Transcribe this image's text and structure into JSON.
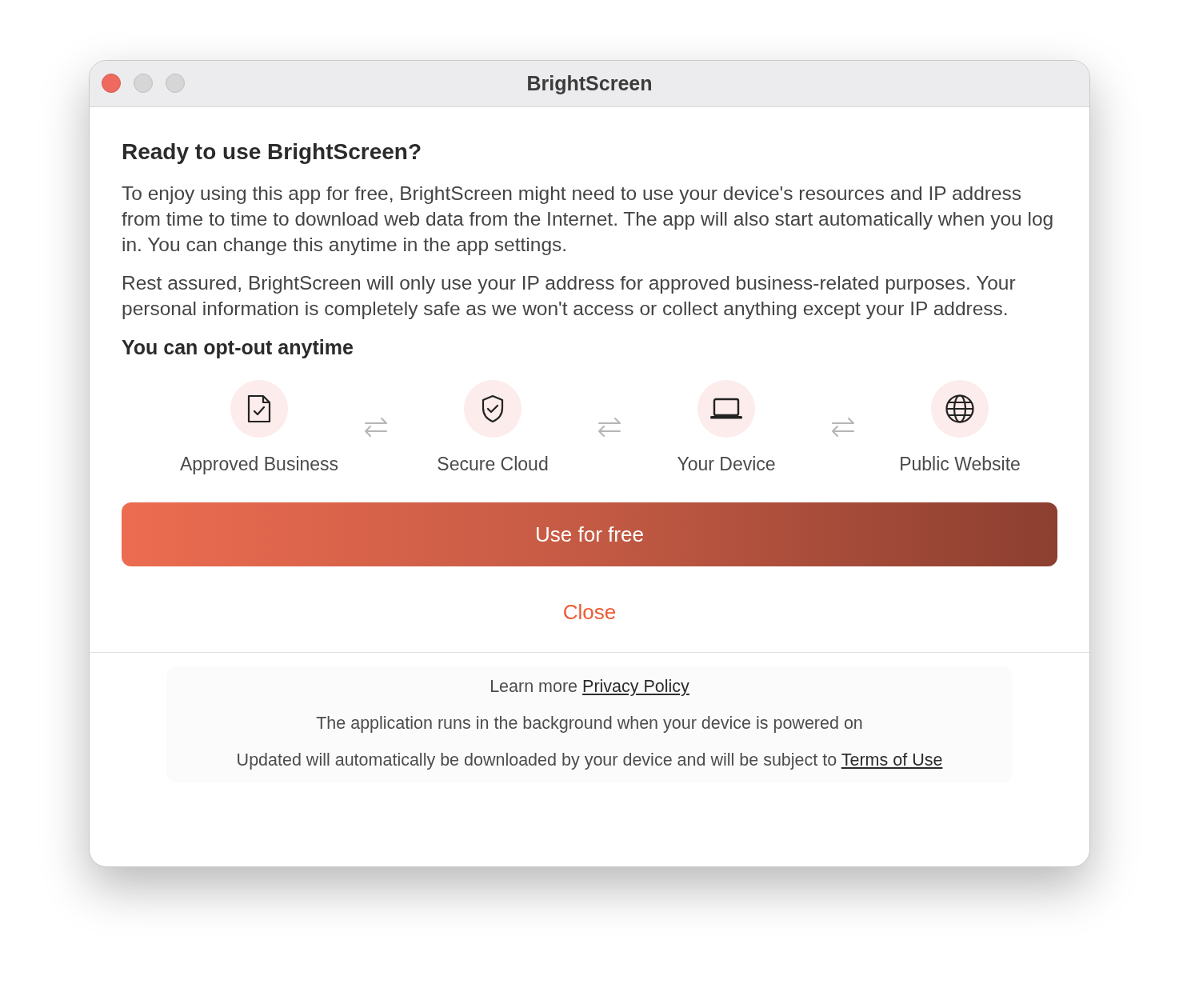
{
  "window": {
    "title": "BrightScreen"
  },
  "heading": "Ready to use BrightScreen?",
  "paragraphs": [
    "To enjoy using this app for free, BrightScreen might need to use your device's resources and IP address from time to time to download web data from the Internet. The app will also start automatically when you log in. You can change this anytime in the app settings.",
    "Rest assured, BrightScreen will only use your IP address for approved business-related purposes. Your personal information is completely safe as we won't access or collect anything except your IP address."
  ],
  "subheading": "You can opt-out anytime",
  "steps": [
    {
      "kind": "document",
      "label": "Approved Business"
    },
    {
      "kind": "shield",
      "label": "Secure Cloud"
    },
    {
      "kind": "laptop",
      "label": "Your Device"
    },
    {
      "kind": "globe",
      "label": "Public Website"
    }
  ],
  "primary_button": "Use for free",
  "secondary_button": "Close",
  "footer": [
    {
      "text": "Learn more ",
      "link": "Privacy Policy"
    },
    {
      "text": "The application runs in the background when your device is powered on"
    },
    {
      "text": "Updated will automatically be downloaded by your device and will be subject to ",
      "link": "Terms of Use"
    }
  ]
}
